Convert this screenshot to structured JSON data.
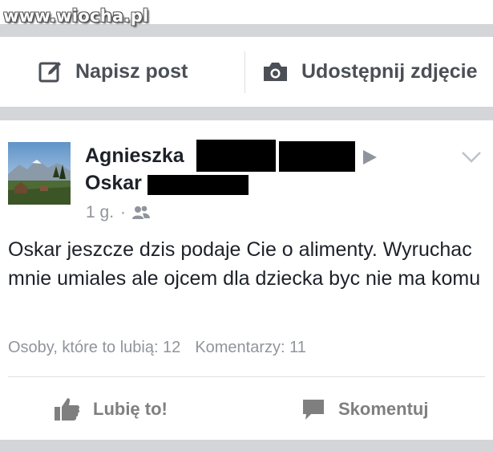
{
  "watermark": "www.wiocha.pl",
  "composer": {
    "write_post": "Napisz post",
    "share_photo": "Udostępnij zdjęcie"
  },
  "post": {
    "author_first": "Agnieszka",
    "recipient_first": "Oskar",
    "time": "1 g.",
    "audience_icon": "friends-icon",
    "text": "Oskar jeszcze dzis podaje Cie o alimenty. Wyruchac mnie umiales ale ojcem dla dziecka byc nie ma komu",
    "likes_label": "Osoby, które to lubią: 12",
    "comments_label": "Komentarzy: 11",
    "like_button": "Lubię to!",
    "comment_button": "Skomentuj"
  },
  "colors": {
    "divider": "#d3d5d9",
    "secondary_text": "#90949c",
    "action_text": "#4b4f56"
  }
}
